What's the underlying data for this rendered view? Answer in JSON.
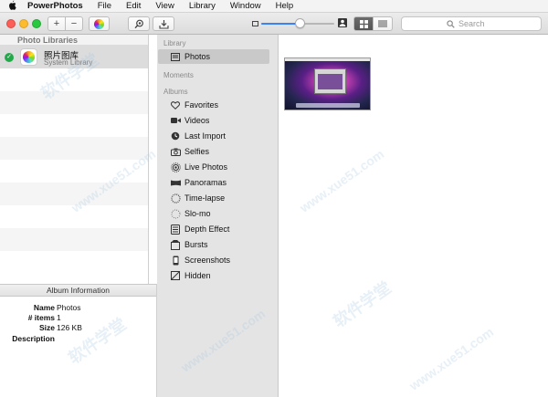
{
  "menubar": {
    "apple_icon": "apple-logo-icon",
    "app_name": "PowerPhotos",
    "items": [
      "File",
      "Edit",
      "View",
      "Library",
      "Window",
      "Help"
    ]
  },
  "toolbar": {
    "add_label": "+",
    "remove_label": "−",
    "zoom": {
      "value_fraction": 0.52
    },
    "search": {
      "placeholder": "Search",
      "value": ""
    },
    "active_view": "grid",
    "accent_color": "#3b82f6"
  },
  "libraries": {
    "header": "Photo Libraries",
    "items": [
      {
        "name": "照片图库",
        "subtitle": "System Library",
        "status": "check-icon",
        "status_color": "#22a94a"
      }
    ]
  },
  "album_info": {
    "title": "Album Information",
    "rows": [
      {
        "key": "Name",
        "value": "Photos"
      },
      {
        "key": "# items",
        "value": "1"
      },
      {
        "key": "Size",
        "value": "126 KB"
      },
      {
        "key": "Description",
        "value": ""
      }
    ]
  },
  "sidebar": {
    "sections": {
      "library": "Library",
      "moments": "Moments",
      "albums": "Albums"
    },
    "library_items": [
      {
        "label": "Photos",
        "icon": "photos-grid-icon",
        "selected": true
      }
    ],
    "album_items": [
      {
        "label": "Favorites",
        "icon": "heart-icon"
      },
      {
        "label": "Videos",
        "icon": "video-camera-icon"
      },
      {
        "label": "Last Import",
        "icon": "clock-icon"
      },
      {
        "label": "Selfies",
        "icon": "camera-icon"
      },
      {
        "label": "Live Photos",
        "icon": "live-photos-icon"
      },
      {
        "label": "Panoramas",
        "icon": "panorama-icon"
      },
      {
        "label": "Time-lapse",
        "icon": "timelapse-icon"
      },
      {
        "label": "Slo-mo",
        "icon": "slomo-icon"
      },
      {
        "label": "Depth Effect",
        "icon": "depth-effect-icon"
      },
      {
        "label": "Bursts",
        "icon": "bursts-icon"
      },
      {
        "label": "Screenshots",
        "icon": "screenshot-icon"
      },
      {
        "label": "Hidden",
        "icon": "hidden-icon"
      }
    ]
  },
  "watermark": {
    "text_cn": "软件学堂",
    "text_url": "www.xue51.com"
  }
}
